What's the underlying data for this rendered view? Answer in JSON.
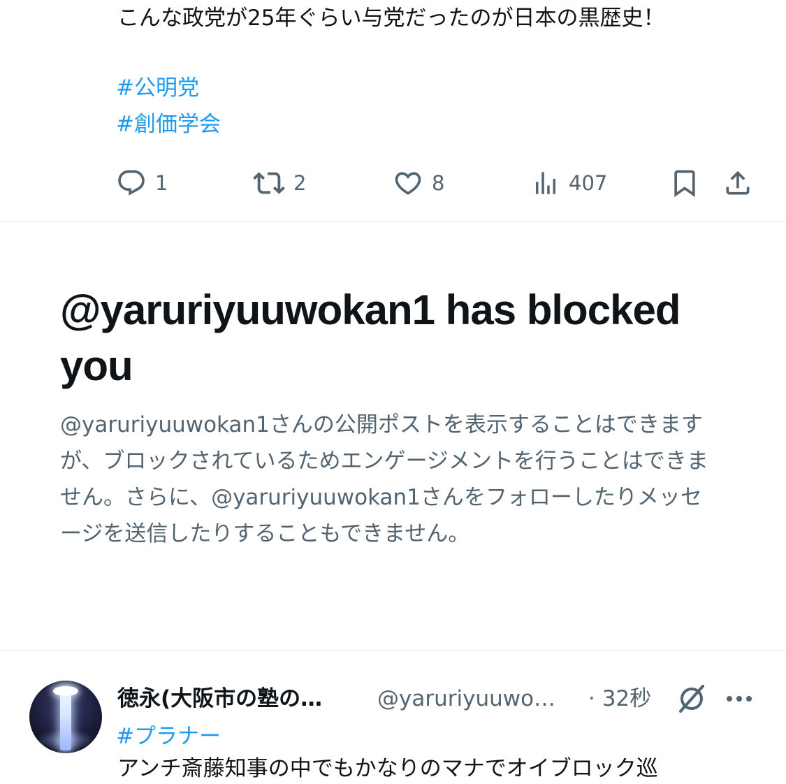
{
  "post": {
    "text": "こんな政党が25年ぐらい与党だったのが日本の黒歴史！",
    "hashtags": [
      "#公明党",
      "#創価学会"
    ],
    "actions": {
      "reply_count": "1",
      "repost_count": "2",
      "like_count": "8",
      "views_count": "407"
    }
  },
  "blocked_notice": {
    "title": "@yaruriyuuwokan1 has blocked you",
    "description": "@yaruriyuuwokan1さんの公開ポストを表示することはできますが、ブロックされているためエンゲージメントを行うことはできません。さらに、@yaruriyuuwokan1さんをフォローしたりメッセージを送信したりすることもできません。"
  },
  "next_post": {
    "display_name": "徳永(大阪市の塾の…",
    "handle": "@yaruriyuuwo…",
    "time": "· 32秒",
    "hashtag": "#プラナー",
    "text_partial": "アンチ斎藤知事の中でもかなりのマナでオイブロック巡"
  },
  "colors": {
    "link": "#1d9bf0",
    "secondary_text": "#536471",
    "primary_text": "#0f1419",
    "divider": "#eff3f4"
  },
  "icons": [
    "reply-icon",
    "repost-icon",
    "like-icon",
    "views-icon",
    "bookmark-icon",
    "share-icon",
    "grok-icon",
    "more-icon"
  ]
}
